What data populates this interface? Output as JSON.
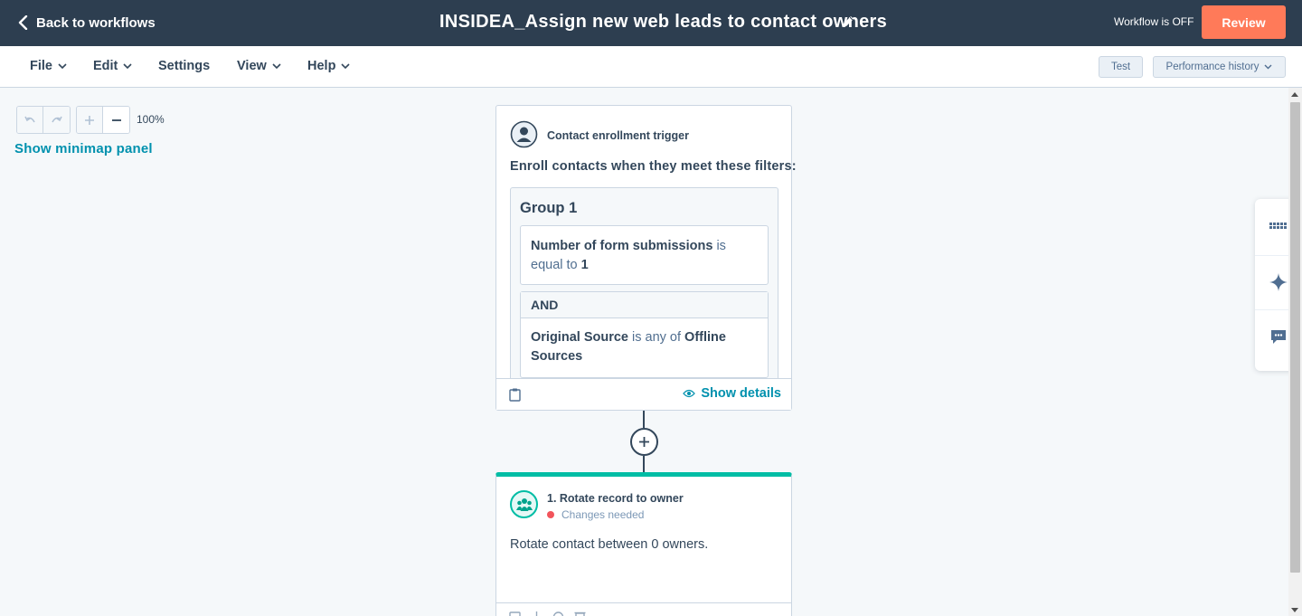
{
  "topbar": {
    "back_label": "Back to workflows",
    "workflow_title": "INSIDEA_Assign new web leads to contact owners",
    "status_text": "Workflow is OFF",
    "review_label": "Review"
  },
  "menubar": {
    "items": [
      {
        "label": "File",
        "has_dropdown": true
      },
      {
        "label": "Edit",
        "has_dropdown": true
      },
      {
        "label": "Settings",
        "has_dropdown": false
      },
      {
        "label": "View",
        "has_dropdown": true
      },
      {
        "label": "Help",
        "has_dropdown": true
      }
    ],
    "test_label": "Test",
    "performance_label": "Performance history"
  },
  "canvas": {
    "zoom_level": "100%",
    "minimap_label": "Show minimap panel"
  },
  "trigger_card": {
    "heading": "Contact enrollment trigger",
    "enroll_text": "Enroll contacts when they meet these filters:",
    "group_title": "Group 1",
    "filter_1": {
      "property": "Number of form submissions",
      "operator": "is equal to",
      "value": "1"
    },
    "and_label": "AND",
    "filter_2": {
      "property": "Original Source",
      "operator": "is any of",
      "value": "Offline Sources"
    },
    "show_details_label": "Show details"
  },
  "action_card": {
    "heading": "1. Rotate record to owner",
    "status_text": "Changes needed",
    "description": "Rotate contact between 0 owners."
  },
  "colors": {
    "topbar_bg": "#2d3e50",
    "review_btn": "#ff7a59",
    "link_teal": "#0091ae",
    "action_accent": "#00bda5",
    "status_red": "#f2545b"
  },
  "icons": {
    "back": "chevron-left-icon",
    "edit_title": "pencil-icon",
    "undo": "undo-icon",
    "redo": "redo-icon",
    "zoom_in": "plus-icon",
    "zoom_out": "minus-icon",
    "trigger": "contact-avatar-icon",
    "clipboard": "clipboard-icon",
    "eye": "eye-icon",
    "add_action": "plus-circle-icon",
    "rotate_action": "team-icon",
    "side_apps": "grid-icon",
    "side_ai": "sparkle-icon",
    "side_chat": "chat-icon"
  }
}
